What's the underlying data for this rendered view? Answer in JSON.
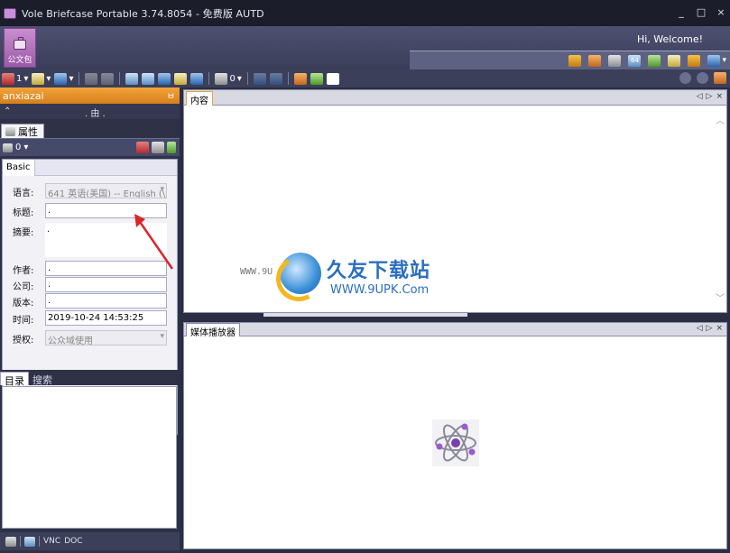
{
  "window": {
    "title": "Vole Briefcase Portable  3.74.8054 - 免费版 AUTD",
    "minimize": "_",
    "maximize": "□",
    "close": "×"
  },
  "ribbon": {
    "briefcase_label": "公文包",
    "welcome": "Hi, Welcome!",
    "icons": [
      "palette-icon",
      "star-icon",
      "book-icon",
      "calendar-icon",
      "wand-icon",
      "lightbulb-icon",
      "info-icon"
    ],
    "calendar_text": "64",
    "info_dropdown": "▾"
  },
  "toolbar": {
    "counter1": "1",
    "counter2": "0",
    "dropdown": "▾"
  },
  "left_panel": {
    "header_title": "anxiazai",
    "pin": "ㅂ",
    "tree_toggle": "⌃",
    "tree_text": ". 由 .",
    "tab_label": "属性",
    "prop_counter": "0",
    "basic_tab": "Basic",
    "fields": {
      "language_label": "语言:",
      "language_value": "641 英语(美国) -- English (\\",
      "title_label": "标题:",
      "title_value": ".",
      "summary_label": "摘要:",
      "summary_value": ".",
      "author_label": "作者:",
      "author_value": ".",
      "company_label": "公司:",
      "company_value": ".",
      "version_label": "版本:",
      "version_value": ".",
      "time_label": "时间:",
      "time_value": "2019-10-24 14:53:25",
      "rights_label": "授权:",
      "rights_value": "公众域使用"
    },
    "lower_tabs": [
      "目录",
      "搜索"
    ],
    "bottom_bar": {
      "labels": [
        "VNC",
        "DOC"
      ]
    }
  },
  "content_panel": {
    "tab_label": "内容",
    "controls": [
      "◁",
      "▷",
      "×"
    ]
  },
  "media_panel": {
    "tab_label": "媒体播放器",
    "controls": [
      "◁",
      "▷",
      "×"
    ]
  },
  "watermark": {
    "brand": "久友下载站",
    "url": "WWW.9UPK.Com",
    "side_text": "WWW.9U"
  },
  "colors": {
    "accent_orange": "#e8952a",
    "title_bar": "#1b1d2b",
    "ribbon": "#4d5171",
    "briefcase": "#b577c2",
    "annotation_arrow": "#d9252b"
  }
}
